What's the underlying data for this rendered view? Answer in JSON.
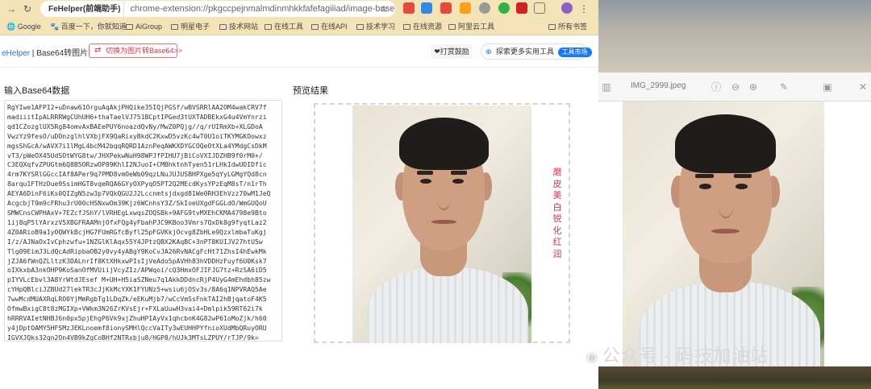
{
  "browser": {
    "site_chip": "FeHelper(前端助手)",
    "url": "chrome-extension://pkgccpejnmalmdinmhkkfafefagiiiad/image-base64/i...",
    "bookmarks": [
      "Google",
      "百度一下，你就知道",
      "AiGroup",
      "明星电子",
      "技术网站",
      "在线工具",
      "在线API",
      "技术学习",
      "在线资源",
      "阿里云工具",
      "所有书签"
    ]
  },
  "app": {
    "brand_fe": "eHelper",
    "brand_sep": " | ",
    "brand_page": "Base64转图片",
    "switch_label": "切换为图片转Base64>>",
    "donate_label": "打赏鼓励",
    "explore_label": "探索更多实用工具",
    "market_tag": "工具市场",
    "input_title": "输入Base64数据",
    "preview_title": "预览结果",
    "base64_text": "RgYIwe1AFPI2+uDnaw61OrguAqAkjPHQike35IQjPGSf/wBVSRRlAA2OM4wakCRV7f\nmadiiitIpALRRRWgCUhUH6+thaTaelVJ751BCptIPGed3tUXTADBEkxG4u4VmYnrzi\nqd1CZozglUX5Rg84omvAxBAEePUY6noazdQvNy/MwZ0PQjg//q/rUIRmXb+XLGDoA\nVwzYz9fesO/uDOnzglhlVXbjFX9QaRixyBkdC2KxwD5vzKc4wT0U1oiTKYMGKOowxz\nmgsShGcA/wAVX7i1lMgL4bcM42bqqRQRD1AznPeqAWKXDYGCOQeOtXLa4YMdgCsDkM\nvT3/pWeOX45UdSOtWYG8tw/JHXPekwNuH98WPJfPIHU7jBiCoVXIJDZHB9f0rM0+/\nC3EQXqfvZPUGtm6Q8B5ORzwOP89KhlI2NJuoI+CMBhktnhTyen51rLHkIdwUDIDfic\n4rm7KYSRlGGccIAf8APer9q7PMD8vmOeWb09qzLNuJUJUSBHPXge5qYyLGMgYQd8cn\n8arqu1FTHzDue9SsimHGT8vqeRQA6GYyOXPyqO5PT2Q2MEcdKysYPzEqM8sT/n1rTh\nAEYA6DinF6iKs0QIZgN5zw3p7VQkQGU2J2Lccnmtsjdxgd81We0RH3EhVzz70wM1JeQ\nAcgcbjT9m9cFRhu3rU00cHSNxwOm39Kjz6WCnhsY3Z/SkIoeUXgdFGGLdO/WmGUQoU\nSMWCnsCWPHAxV+7EZcfJShY/lVRHEgLxwqsZOQSBk+9AFG9tvMXEhCKMA4798e9Bto\n1ij8qP5lYArxzV5XBGFRAAMnjOfxFQg4yFbahPJC9KBoo3Vmrs7QxDk8g9fyqtLaz2\n4Z0ARioB9a1yOQWYkBcjHG7FUmRGfcByfl25pFGVKkjOcvg8ZbHLe9QzxlmbaTuKgj\nI/z/AJNaOxIvCphzwfu+1NZGlKlAqx55Y4JPtzQBX2KAqBC+3nPT8KUIJV27htU5w\nTlg09EimJ3LdQcAdRipbaOB2y0vy4yABgY9KoCvJA26RvNACgFcHt71ZhsI4hEwkMk\njZJA6fWnQZLltzK3DALnrIf8KtXHkxwPIsIjVeAdo5pAVHh83hVDDHzFuyf6U0Ksk7\noIXkxbA3nkOHP9KoSanOfMVUiijVcyZIz/APWqoi/cQ3HmxOFJIFJG7tz+RzSA6iD5\npIYVLcEbvl3A8YrWtdJEsef M+UH+H5iaSZNeu7q1AkkDDdncRjP4UyG4mEhdbh85zw\ncYHpQBlciJZBUd27lekTR3cJjKkMcYXK1FYUNz5+wsiu6jOSv3s/8A6q1NPVRAQ5Ae\n7wwMcdMUAXRqLRO0YjMmRgbTg1LDqZk/eEKuMjb7/wCcVmSsFnkTAI2hBjqatoF4K5\nOfmwBxigC8t8zMGIXp+VWkm3N26ZrKVsEjr+FXLaUuwH3vai4+Dmlpik59RT62i7k\nhRRRVAIetNHBJ6n0px5pjEhgP6Vk9xjZhuHPIAyVx1qhcbnK4G82wP61oMoZjk/h60\ny4jDptOAMY5HFSMzJEKLnoemf8ionySMHlQccVaITy3wEUHHPYfnioXUdMbQRuyORU\nIGVXJQks32qn2On4VB9kZgCoBHf2NTRxbju8/HGP8/hUJk3MTsLZPUY/rTJP/9k="
  },
  "preview_labels": [
    "磨皮",
    "美白",
    "锐化",
    "红润"
  ],
  "mac_preview": {
    "filename": "IMG_2999.jpeg"
  },
  "watermark": "公众号 · 码技加油站"
}
